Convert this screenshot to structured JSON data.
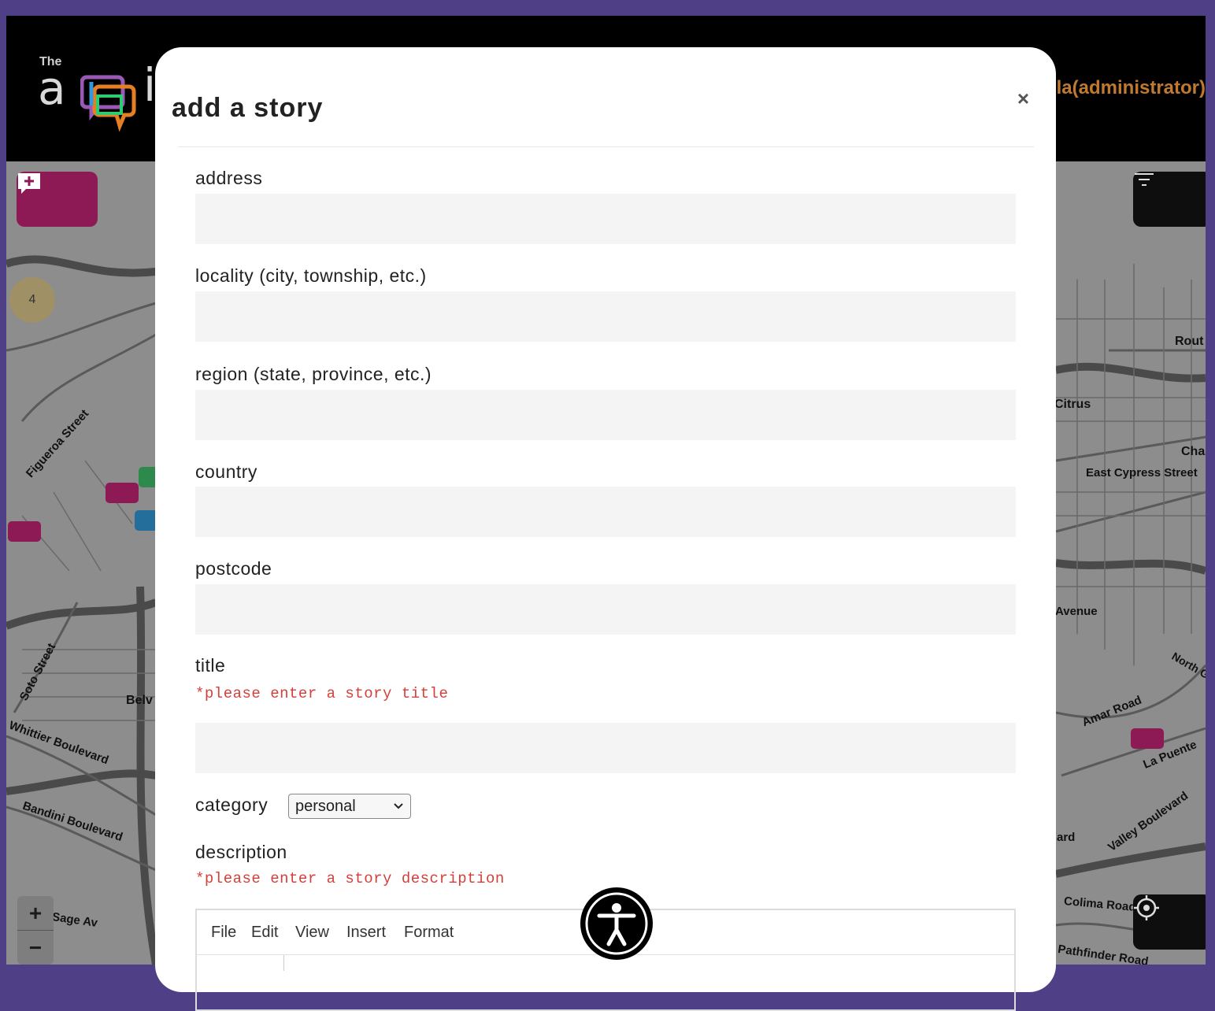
{
  "header": {
    "logo_the": "The",
    "logo_a": "a",
    "logo_i": "i",
    "user_label": "illa(administrator)"
  },
  "map": {
    "cluster_count": "4",
    "streets": {
      "figueroa": "Figueroa Street",
      "soto": "Soto Street",
      "whittier": "Whittier Boulevard",
      "bandini": "Bandini Boulevard",
      "sage": "Sage Av",
      "belv": "Belv",
      "rout": "Rout",
      "citrus": "Citrus",
      "cha": "Cha",
      "east_cypress": "East Cypress Street",
      "avenue": "Avenue",
      "north_g": "North G",
      "amar": "Amar Road",
      "la_puente": "La Puente",
      "ard": "ard",
      "valley": "Valley Boulevard",
      "colima": "Colima Road",
      "pathfinder": "Pathfinder Road"
    },
    "zoom_in": "+",
    "zoom_out": "−"
  },
  "modal": {
    "title": "add a story",
    "close": "×",
    "fields": {
      "address": {
        "label": "address",
        "value": ""
      },
      "locality": {
        "label": "locality (city, township, etc.)",
        "value": ""
      },
      "region": {
        "label": "region (state, province, etc.)",
        "value": ""
      },
      "country": {
        "label": "country",
        "value": ""
      },
      "postcode": {
        "label": "postcode",
        "value": ""
      },
      "title": {
        "label": "title",
        "error": "*please enter a story title",
        "value": ""
      }
    },
    "category": {
      "label": "category",
      "selected": "personal"
    },
    "description": {
      "label": "description",
      "error": "*please enter a story description",
      "menu": [
        "File",
        "Edit",
        "View",
        "Insert",
        "Format"
      ]
    }
  },
  "colors": {
    "page_frame": "#4f3f86",
    "accent_magenta": "#8e1a55",
    "error_red": "#d43f3a",
    "user_orange": "#c07a2f"
  }
}
